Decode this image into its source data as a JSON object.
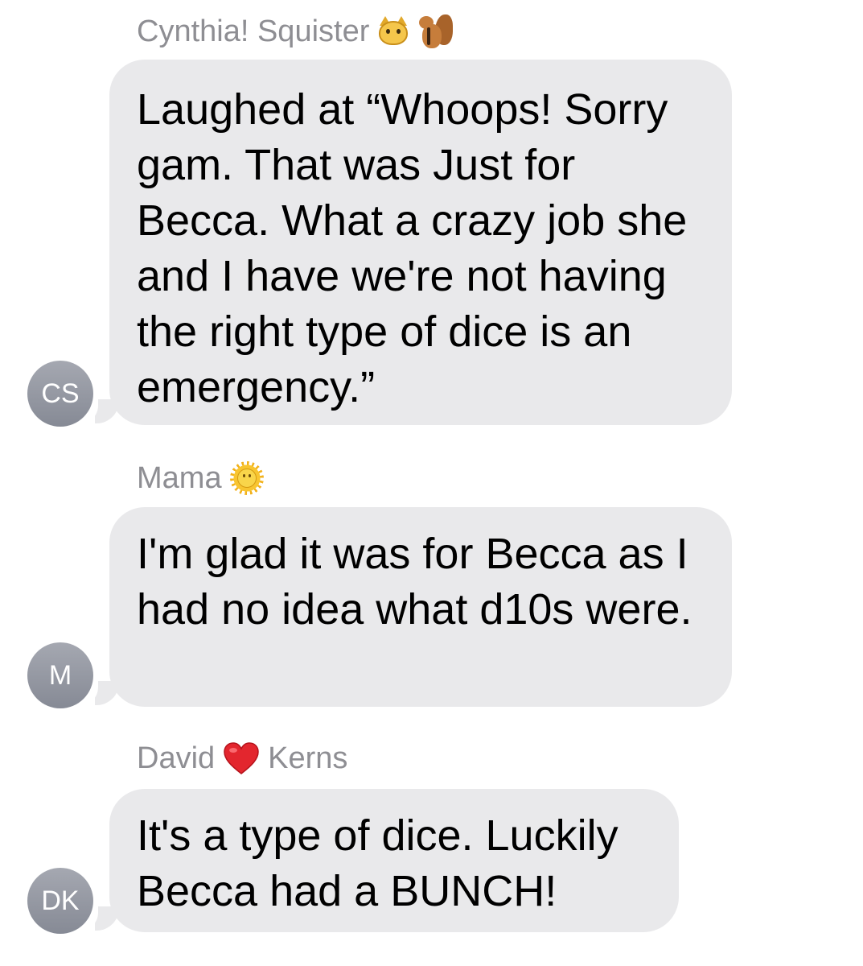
{
  "messages": [
    {
      "sender_first": "Cynthia! Squister",
      "sender_icons": [
        "cat-face-icon",
        "chipmunk-icon"
      ],
      "avatar_initials": "CS",
      "text": "Laughed at “Whoops! Sorry gam. That was Just for Becca. What a crazy job she and I have we're not having the right type of dice is an emergency.”"
    },
    {
      "sender_first": "Mama",
      "sender_icons": [
        "sun-with-face-icon"
      ],
      "avatar_initials": "M",
      "text": "I'm glad it was for Becca as I had no idea what d10s were."
    },
    {
      "sender_first": "David",
      "sender_icons": [
        "red-heart-icon"
      ],
      "sender_last": "Kerns",
      "avatar_initials": "DK",
      "text": "It's a type of dice. Luckily Becca had a BUNCH!"
    }
  ],
  "colors": {
    "bubble_background": "#e9e9eb",
    "sender_name": "#8e8e93",
    "avatar_background": "#9a9ea8",
    "message_text": "#000000"
  }
}
